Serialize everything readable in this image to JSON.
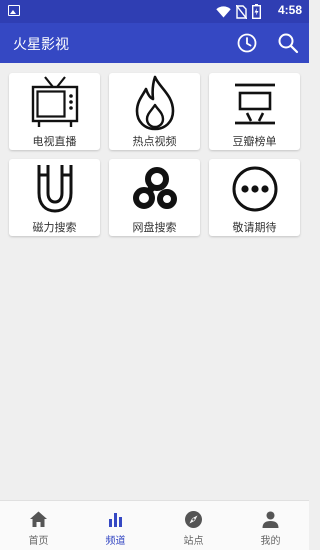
{
  "status_bar": {
    "time": "4:58",
    "icons": [
      "wifi-icon",
      "no-sim-icon",
      "battery-icon"
    ]
  },
  "app_bar": {
    "title": "火星影视",
    "icons": [
      "history-icon",
      "search-icon"
    ]
  },
  "channels": [
    {
      "label": "电视直播",
      "icon": "tv-icon"
    },
    {
      "label": "热点视频",
      "icon": "flame-icon"
    },
    {
      "label": "豆瓣榜单",
      "icon": "douban-icon"
    },
    {
      "label": "磁力搜索",
      "icon": "magnet-icon"
    },
    {
      "label": "网盘搜索",
      "icon": "cloud-drive-icon"
    },
    {
      "label": "敬请期待",
      "icon": "more-icon"
    }
  ],
  "bottom_nav": {
    "items": [
      {
        "label": "首页",
        "icon": "home-icon",
        "active": false
      },
      {
        "label": "频道",
        "icon": "bar-chart-icon",
        "active": true
      },
      {
        "label": "站点",
        "icon": "compass-icon",
        "active": false
      },
      {
        "label": "我的",
        "icon": "person-icon",
        "active": false
      }
    ]
  },
  "colors": {
    "primary": "#3548c3",
    "status_bar": "#2f3eb3",
    "background": "#efefef",
    "active_nav": "#3548c3"
  }
}
